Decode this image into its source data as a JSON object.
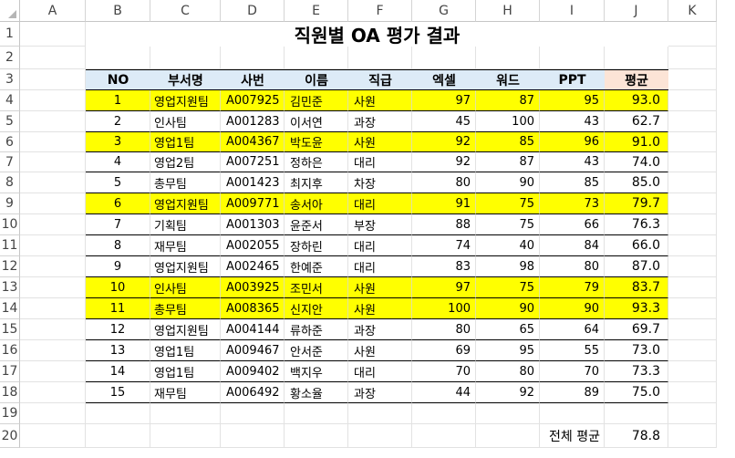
{
  "columns": [
    "A",
    "B",
    "C",
    "D",
    "E",
    "F",
    "G",
    "H",
    "I",
    "J",
    "K"
  ],
  "rows": [
    "1",
    "2",
    "3",
    "4",
    "5",
    "6",
    "7",
    "8",
    "9",
    "10",
    "11",
    "12",
    "13",
    "14",
    "15",
    "16",
    "17",
    "18",
    "19",
    "20"
  ],
  "title": "직원별 OA 평가 결과",
  "headers": {
    "no": "NO",
    "dept": "부서명",
    "id": "사번",
    "name": "이름",
    "rank": "직급",
    "excel": "엑셀",
    "word": "워드",
    "ppt": "PPT",
    "avg": "평균"
  },
  "records": [
    {
      "no": "1",
      "dept": "영업지원팀",
      "id": "A007925",
      "name": "김민준",
      "rank": "사원",
      "excel": "97",
      "word": "87",
      "ppt": "95",
      "avg": "93.0",
      "highlight": true
    },
    {
      "no": "2",
      "dept": "인사팀",
      "id": "A001283",
      "name": "이서연",
      "rank": "과장",
      "excel": "45",
      "word": "100",
      "ppt": "43",
      "avg": "62.7",
      "highlight": false
    },
    {
      "no": "3",
      "dept": "영업1팀",
      "id": "A004367",
      "name": "박도윤",
      "rank": "사원",
      "excel": "92",
      "word": "85",
      "ppt": "96",
      "avg": "91.0",
      "highlight": true
    },
    {
      "no": "4",
      "dept": "영업2팀",
      "id": "A007251",
      "name": "정하은",
      "rank": "대리",
      "excel": "92",
      "word": "87",
      "ppt": "43",
      "avg": "74.0",
      "highlight": false
    },
    {
      "no": "5",
      "dept": "총무팀",
      "id": "A001423",
      "name": "최지후",
      "rank": "차장",
      "excel": "80",
      "word": "90",
      "ppt": "85",
      "avg": "85.0",
      "highlight": false
    },
    {
      "no": "6",
      "dept": "영업지원팀",
      "id": "A009771",
      "name": "송서아",
      "rank": "대리",
      "excel": "91",
      "word": "75",
      "ppt": "73",
      "avg": "79.7",
      "highlight": true
    },
    {
      "no": "7",
      "dept": "기획팀",
      "id": "A001303",
      "name": "윤준서",
      "rank": "부장",
      "excel": "88",
      "word": "75",
      "ppt": "66",
      "avg": "76.3",
      "highlight": false
    },
    {
      "no": "8",
      "dept": "재무팀",
      "id": "A002055",
      "name": "장하린",
      "rank": "대리",
      "excel": "74",
      "word": "40",
      "ppt": "84",
      "avg": "66.0",
      "highlight": false
    },
    {
      "no": "9",
      "dept": "영업지원팀",
      "id": "A002465",
      "name": "한예준",
      "rank": "대리",
      "excel": "83",
      "word": "98",
      "ppt": "80",
      "avg": "87.0",
      "highlight": false
    },
    {
      "no": "10",
      "dept": "인사팀",
      "id": "A003925",
      "name": "조민서",
      "rank": "사원",
      "excel": "97",
      "word": "75",
      "ppt": "79",
      "avg": "83.7",
      "highlight": true
    },
    {
      "no": "11",
      "dept": "총무팀",
      "id": "A008365",
      "name": "신지안",
      "rank": "사원",
      "excel": "100",
      "word": "90",
      "ppt": "90",
      "avg": "93.3",
      "highlight": true
    },
    {
      "no": "12",
      "dept": "영업지원팀",
      "id": "A004144",
      "name": "류하준",
      "rank": "과장",
      "excel": "80",
      "word": "65",
      "ppt": "64",
      "avg": "69.7",
      "highlight": false
    },
    {
      "no": "13",
      "dept": "영업1팀",
      "id": "A009467",
      "name": "안서준",
      "rank": "사원",
      "excel": "69",
      "word": "95",
      "ppt": "55",
      "avg": "73.0",
      "highlight": false
    },
    {
      "no": "14",
      "dept": "영업1팀",
      "id": "A009402",
      "name": "백지우",
      "rank": "대리",
      "excel": "70",
      "word": "80",
      "ppt": "70",
      "avg": "73.3",
      "highlight": false
    },
    {
      "no": "15",
      "dept": "재무팀",
      "id": "A006492",
      "name": "황소율",
      "rank": "과장",
      "excel": "44",
      "word": "92",
      "ppt": "89",
      "avg": "75.0",
      "highlight": false
    }
  ],
  "total": {
    "label": "전체 평균",
    "value": "78.8"
  },
  "colors": {
    "highlight": "#ffff00",
    "header_fill": "#ddebf7",
    "avg_header_fill": "#fce4d6",
    "border": "#000000"
  }
}
